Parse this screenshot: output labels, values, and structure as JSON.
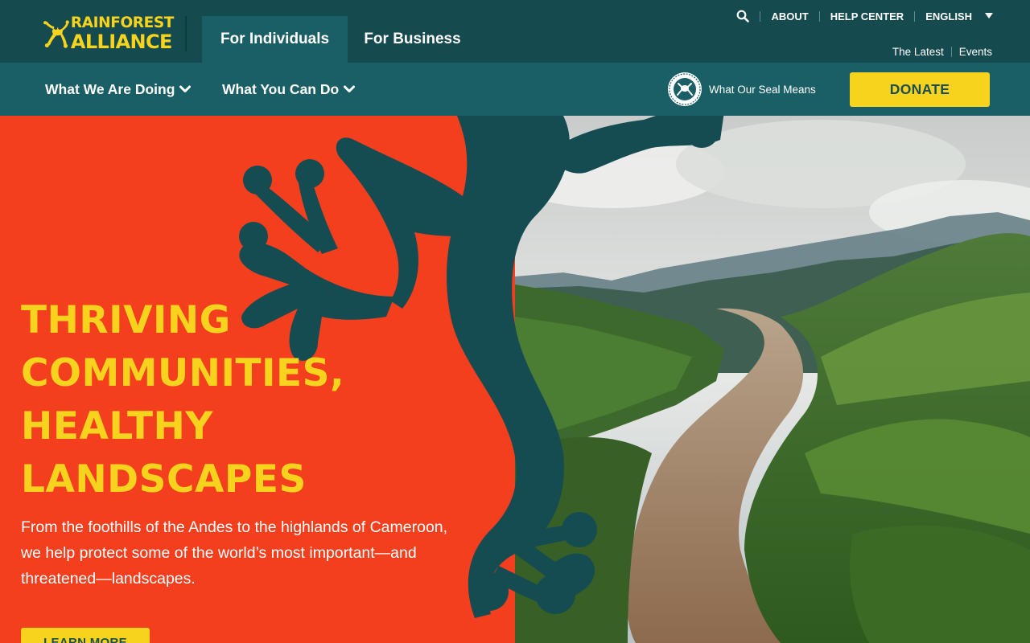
{
  "brand": {
    "name_line1": "RAINFOREST",
    "name_line2": "ALLIANCE",
    "logo_icon": "frog-logo-icon"
  },
  "audience_tabs": [
    {
      "label": "For Individuals",
      "active": true
    },
    {
      "label": "For Business",
      "active": false
    }
  ],
  "utility_nav": {
    "search_icon": "search-icon",
    "about": "ABOUT",
    "help_center": "HELP CENTER",
    "language": "ENGLISH"
  },
  "secondary_nav": {
    "latest": "The Latest",
    "events": "Events"
  },
  "main_nav": {
    "items": [
      {
        "label": "What We Are Doing",
        "icon": "chevron-down-icon"
      },
      {
        "label": "What You Can Do",
        "icon": "chevron-down-icon"
      }
    ],
    "seal_link": "What Our Seal Means",
    "donate": "DONATE"
  },
  "hero": {
    "heading_lines": [
      "THRIVING",
      "COMMUNITIES,",
      "HEALTHY",
      "LANDSCAPES"
    ],
    "body": "From the foothills of the Andes to the highlands of Cameroon, we help protect some of the world’s most important—and threatened—landscapes.",
    "cta": "LEARN MORE"
  },
  "colors": {
    "header_dark": "#154a4e",
    "nav_teal": "#1b5f66",
    "accent_yellow": "#f7d31e",
    "hero_red": "#f43f1e",
    "frog_teal": "#144c52"
  }
}
